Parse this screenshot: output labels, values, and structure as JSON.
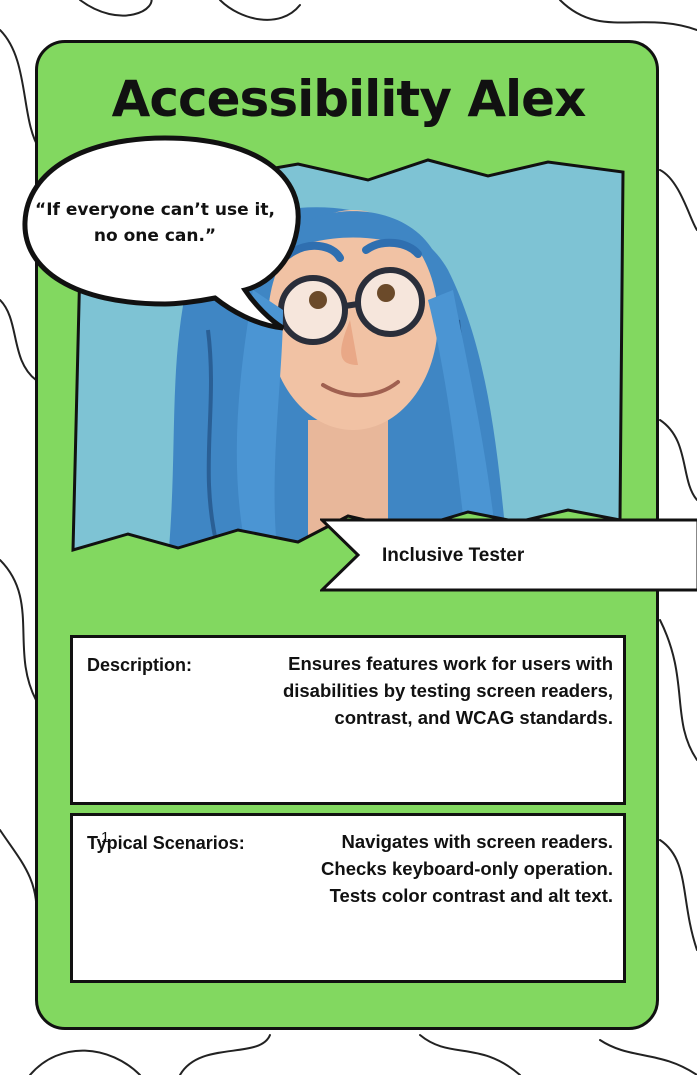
{
  "card": {
    "name": "Accessibility Alex",
    "quote": "“If everyone can’t use it, no one can.”",
    "role": "Inclusive Tester",
    "description": {
      "label": "Description:",
      "lines": [
        "Ensures features work for users with",
        "disabilities by testing screen readers,",
        "contrast, and WCAG standards."
      ]
    },
    "scenarios": {
      "label": "Typical Scenarios:",
      "stray_mark": "1",
      "lines": [
        "Navigates with screen readers.",
        "Checks keyboard-only operation.",
        "Tests color contrast and alt text."
      ]
    },
    "portrait_icon": "blue-haired-person-with-glasses",
    "colors": {
      "card": "#82d860",
      "sky": "#7ec3d4",
      "hair": "#3f86c4",
      "ink": "#111111"
    }
  }
}
